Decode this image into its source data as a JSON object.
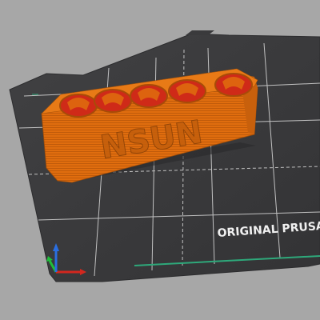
{
  "viewport": {
    "background": "#a7a7a7",
    "bed_color": "#3a3a3c",
    "grid_line_color": "#d9d9d9",
    "bed_label": "ORIGINAL PRUSA",
    "accent_stripe": "#2ea87a"
  },
  "model": {
    "slots": 5,
    "outer_color": "#e06d0e",
    "inner_color": "#cf2a18",
    "embossed_text": "NSUN"
  },
  "axes": {
    "x_color": "#d3271e",
    "y_color": "#1fbf3a",
    "z_color": "#2a6ee0"
  }
}
